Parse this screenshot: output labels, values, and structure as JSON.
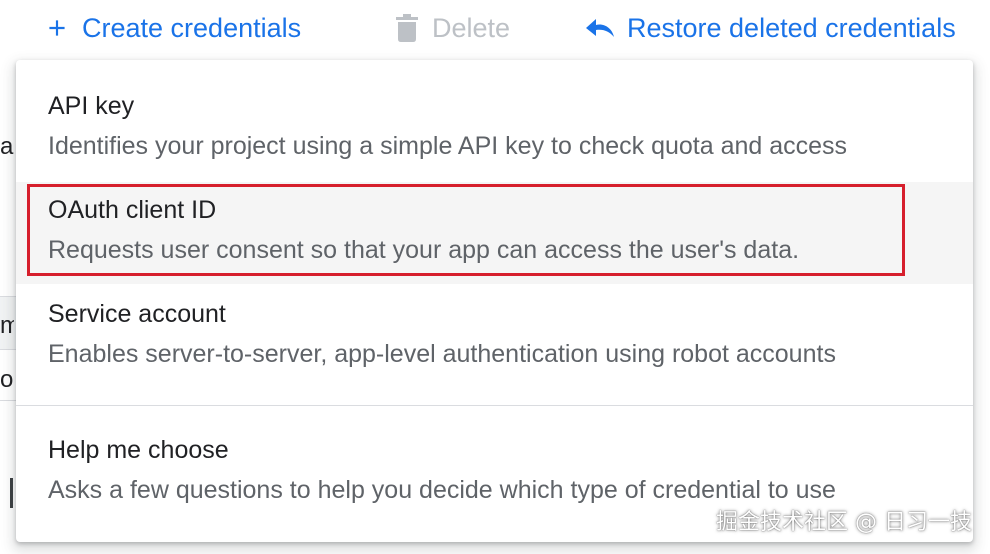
{
  "toolbar": {
    "create_label": "Create credentials",
    "create_icon": "plus-icon",
    "delete_label": "Delete",
    "delete_icon": "trash-icon",
    "restore_label": "Restore deleted credentials",
    "restore_icon": "undo-icon"
  },
  "menu": {
    "items": [
      {
        "title": "API key",
        "description": "Identifies your project using a simple API key to check quota and access"
      },
      {
        "title": "OAuth client ID",
        "description": "Requests user consent so that your app can access the user's data.",
        "highlighted": true
      },
      {
        "title": "Service account",
        "description": "Enables server-to-server, app-level authentication using robot accounts"
      },
      {
        "title": "Help me choose",
        "description": "Asks a few questions to help you decide which type of credential to use"
      }
    ]
  },
  "background": {
    "fragment_1": "a",
    "fragment_2": "m",
    "fragment_3": "ol"
  },
  "watermark": "掘金技术社区 @ 日习一技",
  "colors": {
    "accent": "#1a73e8",
    "disabled": "#bdc1c6",
    "highlight_border": "#d61f2c",
    "hover_bg": "#f5f5f5"
  }
}
